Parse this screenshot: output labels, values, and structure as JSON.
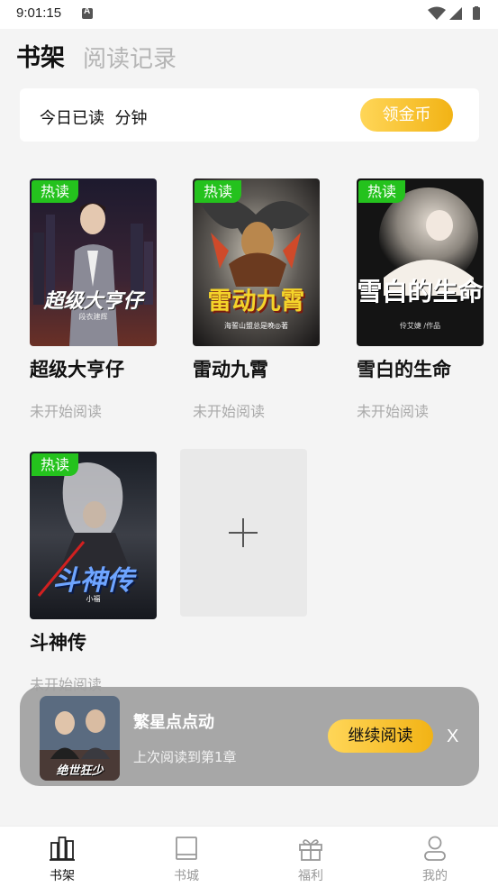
{
  "status_bar": {
    "time": "9:01:15"
  },
  "header": {
    "tab_shelf": "书架",
    "tab_history": "阅读记录"
  },
  "reading_card": {
    "text": "今日已读  分钟",
    "coin_button": "领金币"
  },
  "books": [
    {
      "badge": "热读",
      "title": "超级大亨仔",
      "status": "未开始阅读",
      "cover_title": "超级大亨仔",
      "cover_author": "段衣建辉"
    },
    {
      "badge": "热读",
      "title": "雷动九霄",
      "status": "未开始阅读",
      "cover_title": "雷动九霄",
      "cover_author": "海誓山盟总是晚◎著"
    },
    {
      "badge": "热读",
      "title": "雪白的生命",
      "status": "未开始阅读",
      "cover_title": "雪白的生命",
      "cover_author": "伶艾婕 /作品"
    },
    {
      "badge": "热读",
      "title": "斗神传",
      "status": "未开始阅读",
      "cover_title": "斗神传",
      "cover_author": "小福"
    }
  ],
  "resume_bar": {
    "title": "繁星点点动",
    "subtitle": "上次阅读到第1章",
    "continue_button": "继续阅读",
    "close_label": "X",
    "cover_title": "绝世狂少"
  },
  "bottom_nav": [
    {
      "label": "书架",
      "icon": "bookshelf-icon",
      "active": true
    },
    {
      "label": "书城",
      "icon": "book-icon",
      "active": false
    },
    {
      "label": "福利",
      "icon": "gift-icon",
      "active": false
    },
    {
      "label": "我的",
      "icon": "user-icon",
      "active": false
    }
  ],
  "colors": {
    "accent_gold": "#f2b315",
    "hot_badge": "#24c21d",
    "background": "#f4f4f4"
  }
}
